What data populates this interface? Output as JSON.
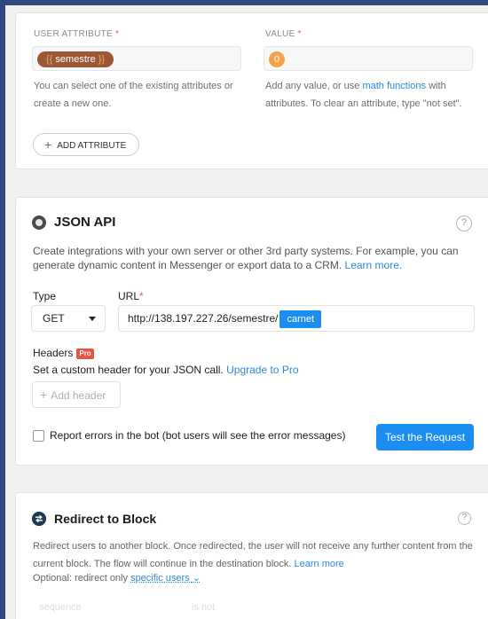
{
  "attribute_card": {
    "attr_label": "USER ATTRIBUTE",
    "attr_required": "*",
    "attr_value_brace_open": "{{",
    "attr_value": "semestre",
    "attr_value_brace_close": "}}",
    "value_label": "VALUE",
    "value_required": "*",
    "value_value": "0",
    "attr_help": "You can select one of the existing attributes or create a new one.",
    "value_help_prefix": "Add any value, or use",
    "value_help_link": "math functions",
    "value_help_suffix": "with attributes. To clear an attribute, type \"not set\".",
    "add_attribute_label": "ADD ATTRIBUTE"
  },
  "json_api": {
    "title": "JSON API",
    "help_icon": "?",
    "description": "Create integrations with your own server or other 3rd party systems. For example, you can generate dynamic content in Messenger or export data to a CRM.",
    "learn_more": "Learn more.",
    "type_label": "Type",
    "type_value": "GET",
    "url_label": "URL",
    "url_required": "*",
    "url_text": "http://138.197.227.26/semestre/",
    "url_chip": "carnet",
    "headers_label": "Headers",
    "pro_badge": "Pro",
    "headers_desc": "Set a custom header for your JSON call.",
    "upgrade_link": "Upgrade to Pro",
    "add_header": "Add header",
    "report_errors": "Report errors in the bot (bot users will see the error messages)",
    "test_button": "Test the Request"
  },
  "redirect": {
    "title": "Redirect to Block",
    "help_icon": "?",
    "description": "Redirect users to another block. Once redirected, the user will not receive any further content from the current block. The flow will continue in the destination block.",
    "learn_more": "Learn more",
    "optional_prefix": "Optional: redirect only",
    "specific_users": "specific users",
    "faded_field": "sequence",
    "faded_op": "is not"
  },
  "colors": {
    "accent": "#1b8df0",
    "attribute_pill": "#9b5836",
    "value_pill": "#f3a44a",
    "pro_badge": "#e6553f"
  },
  "icons": {
    "json_api": "radio-target-icon",
    "redirect": "redirect-arrows-icon",
    "help": "question-circle-icon",
    "plus": "plus-icon",
    "chevron": "chevron-down-icon"
  }
}
